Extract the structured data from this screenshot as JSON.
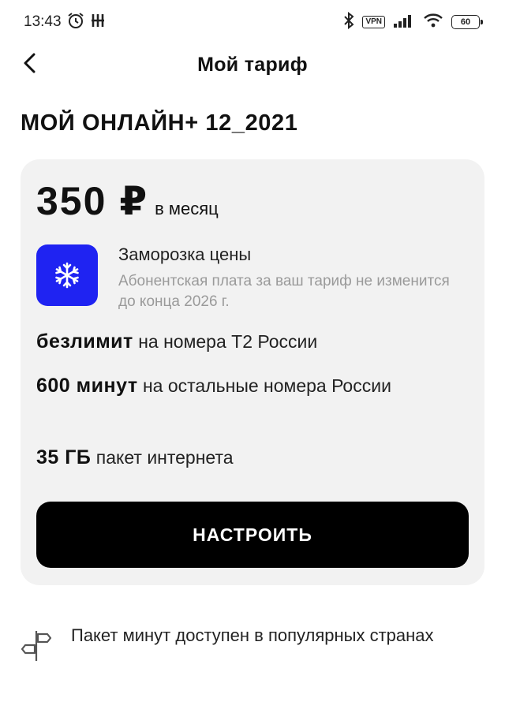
{
  "status_bar": {
    "time": "13:43",
    "vpn": "VPN",
    "battery": "60"
  },
  "header": {
    "title": "Мой тариф"
  },
  "tariff": {
    "name": "МОЙ ОНЛАЙН+ 12_2021",
    "price": "350 ₽",
    "price_unit": "в месяц",
    "freeze_title": "Заморозка цены",
    "freeze_desc": "Абонентская плата за ваш тариф не изменится до конца 2026 г.",
    "features": [
      {
        "highlight": "безлимит",
        "text": "на номера Т2 России"
      },
      {
        "highlight": "600 минут",
        "text": "на остальные номера России"
      },
      {
        "highlight": "35 ГБ",
        "text": "пакет интернета"
      }
    ],
    "configure_label": "НАСТРОИТЬ"
  },
  "info": {
    "text": "Пакет минут доступен в популярных странах"
  },
  "colors": {
    "accent_blue": "#1f23f2",
    "button_bg": "#000000",
    "card_bg": "#f2f2f2"
  }
}
